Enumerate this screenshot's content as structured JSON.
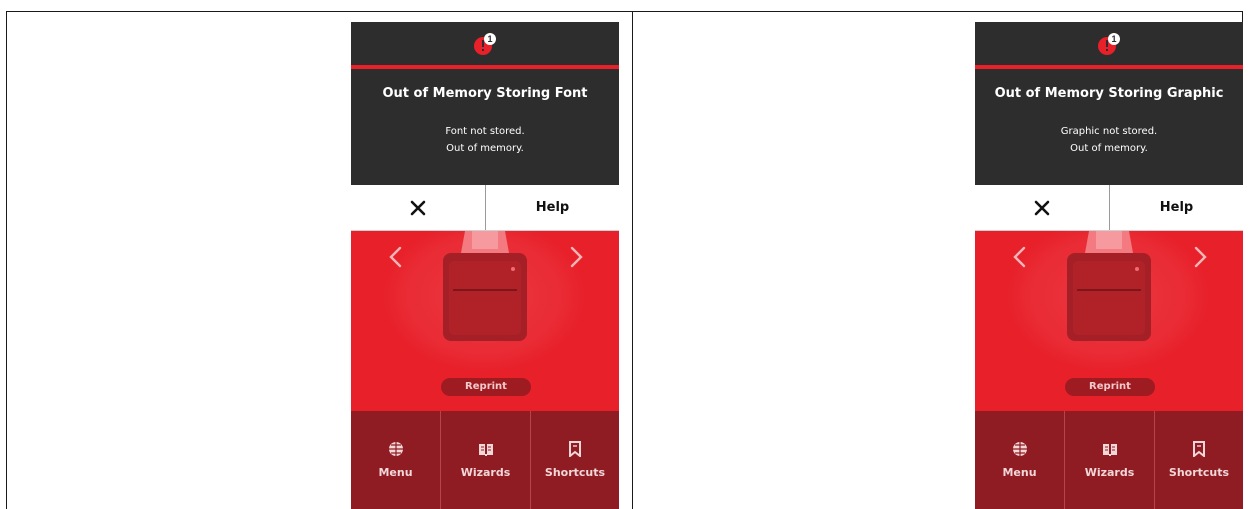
{
  "colors": {
    "brand_red": "#e8202a",
    "dark_panel": "#2d2d2d",
    "bottom_nav": "#8e1c22",
    "reprint_pill": "#9e1b22"
  },
  "screens": [
    {
      "alert_badge": "1",
      "title": "Out of Memory Storing Font",
      "message_line1": "Font not stored.",
      "message_line2": "Out of memory.",
      "close_icon": "close-icon",
      "help_label": "Help",
      "reprint_label": "Reprint",
      "nav": [
        {
          "label": "Menu",
          "icon": "globe-icon"
        },
        {
          "label": "Wizards",
          "icon": "book-icon"
        },
        {
          "label": "Shortcuts",
          "icon": "bookmark-icon"
        }
      ]
    },
    {
      "alert_badge": "1",
      "title": "Out of Memory Storing Graphic",
      "message_line1": "Graphic not stored.",
      "message_line2": "Out of memory.",
      "close_icon": "close-icon",
      "help_label": "Help",
      "reprint_label": "Reprint",
      "nav": [
        {
          "label": "Menu",
          "icon": "globe-icon"
        },
        {
          "label": "Wizards",
          "icon": "book-icon"
        },
        {
          "label": "Shortcuts",
          "icon": "bookmark-icon"
        }
      ]
    }
  ]
}
